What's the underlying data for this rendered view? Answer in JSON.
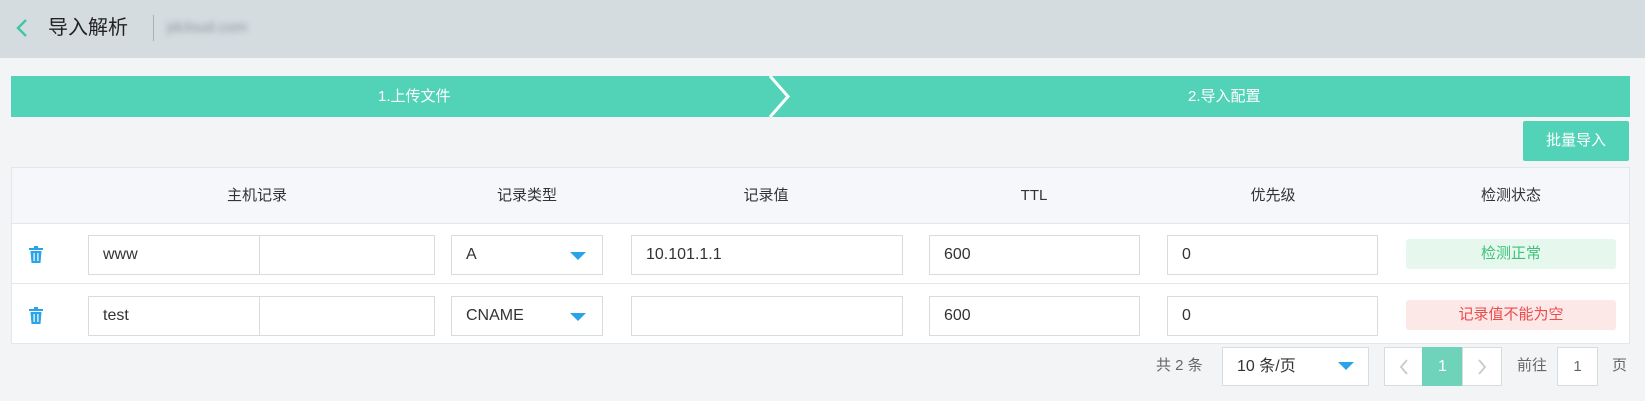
{
  "header": {
    "title": "导入解析",
    "domain": "jdcloud.com"
  },
  "steps": [
    {
      "label": "1.上传文件"
    },
    {
      "label": "2.导入配置"
    }
  ],
  "actions": {
    "batch_import": "批量导入"
  },
  "table": {
    "columns": [
      "主机记录",
      "记录类型",
      "记录值",
      "TTL",
      "优先级",
      "检测状态"
    ],
    "rows": [
      {
        "host": "www",
        "type": "A",
        "value": "10.101.1.1",
        "ttl": "600",
        "priority": "0",
        "status": "检测正常",
        "status_kind": "ok"
      },
      {
        "host": "test",
        "type": "CNAME",
        "value": "",
        "ttl": "600",
        "priority": "0",
        "status": "记录值不能为空",
        "status_kind": "error"
      }
    ]
  },
  "pagination": {
    "total": "共 2 条",
    "page_size": "10 条/页",
    "current_page": "1",
    "goto_label": "前往",
    "goto_value": "1",
    "goto_unit": "页"
  },
  "colors": {
    "accent": "#52d3b7",
    "ok_text": "#3dc27a",
    "error_text": "#ea4b4b",
    "icon_blue": "#2aa4e8"
  },
  "icons": {
    "back": "chevron-left-icon",
    "delete": "trash-icon",
    "dropdown": "caret-down-icon",
    "prev": "chevron-left-icon",
    "next": "chevron-right-icon"
  }
}
